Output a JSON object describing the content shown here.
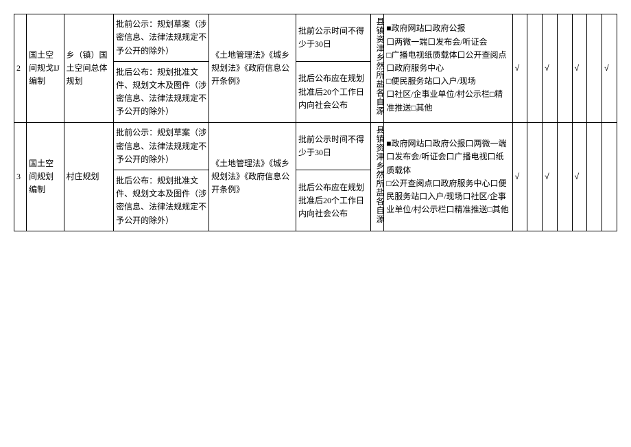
{
  "rows": [
    {
      "num": "2",
      "category": "国土空间规戈IJ编制",
      "plan": "乡（镇）国土空间总体规划",
      "content_pre": "批前公示：规划草案（涉密信息、法律法规规定不予公开的除外）",
      "content_post": "批后公布：规划批准文件、规划文木及图件（涉密信息、法律法规规定不予公开的除外）",
      "basis": "《土地管理法》《城乡规划法》《政府信息公开条例》",
      "time_pre": "批前公示时间不得少于30日",
      "time_post": "批后公布应在规划批准后20个工作日内向社会公布",
      "subject": "县镇资津乡然所盐各自源",
      "channels": "■政府网站口政府公报\n口两微一端口发布会/听证会\n□广播电视纸质载体口公开查阅点口政府服务中心\n□便民服务站口入户/现场\n口社区/企事业单位/村公示栏□精准推送□其他",
      "checks": [
        "√",
        "",
        "√",
        "",
        "√",
        "",
        "√"
      ]
    },
    {
      "num": "3",
      "category": "国土空间规划编制",
      "plan": "村庄规划",
      "content_pre": "批前公示：规划草案（涉密信息、法律法规规定不予公开的除外）",
      "content_post": "批后公布：规划批准文件、规划文本及图件（涉密信息、法律法规规定不予公开的除外）",
      "basis": "《土地管理法》《城乡规划法》《政府信息公开条例》",
      "time_pre": "批前公示时间不得少于30日",
      "time_post": "批后公布应在规划批准后20个工作日内向社会公布",
      "subject": "县镇资津乡然所盐各自源",
      "channels": "■政府网站口政府公报口两微一端口发布会/听证会口广播电视口纸质载体\n□公开查阅点口政府服务中心口便民服务站口入户/现场口社区/企事业单位/村公示栏口精准推送□其他",
      "checks": [
        "√",
        "",
        "√",
        "",
        "√",
        "",
        ""
      ]
    }
  ]
}
